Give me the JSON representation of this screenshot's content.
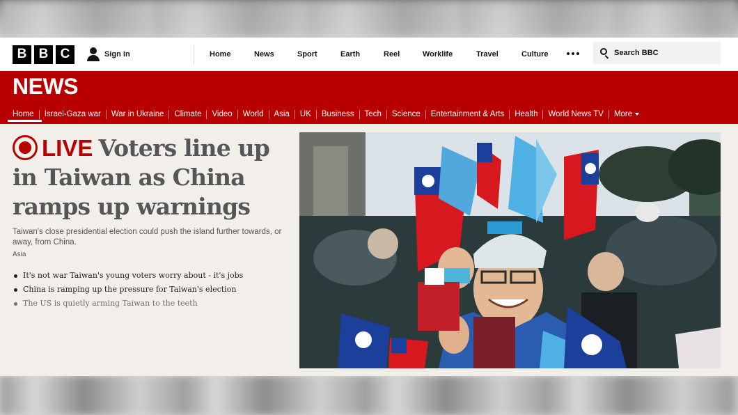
{
  "header": {
    "logo": [
      "B",
      "B",
      "C"
    ],
    "signin_label": "Sign in",
    "nav": [
      "Home",
      "News",
      "Sport",
      "Earth",
      "Reel",
      "Worklife",
      "Travel",
      "Culture"
    ],
    "more_icon": "more-dots-icon",
    "search_placeholder": "Search BBC"
  },
  "news": {
    "wordmark": "NEWS",
    "nav": [
      "Home",
      "Israel-Gaza war",
      "War in Ukraine",
      "Climate",
      "Video",
      "World",
      "Asia",
      "UK",
      "Business",
      "Tech",
      "Science",
      "Entertainment & Arts",
      "Health",
      "World News TV",
      "More"
    ],
    "active": "Home"
  },
  "story": {
    "live_label": "LIVE",
    "headline": "Voters line up in Taiwan as China ramps up warnings",
    "summary": "Taiwan's close presidential election could push the island further towards, or away, from China.",
    "tag": "Asia",
    "related": [
      "It's not war Taiwan's young voters worry about - it's jobs",
      "China is ramping up the pressure for Taiwan's election",
      "The US is quietly arming Taiwan to the teeth"
    ]
  },
  "colors": {
    "brand_red": "#b80000",
    "page_bg": "#f2eeea",
    "text_grey": "#545658"
  }
}
